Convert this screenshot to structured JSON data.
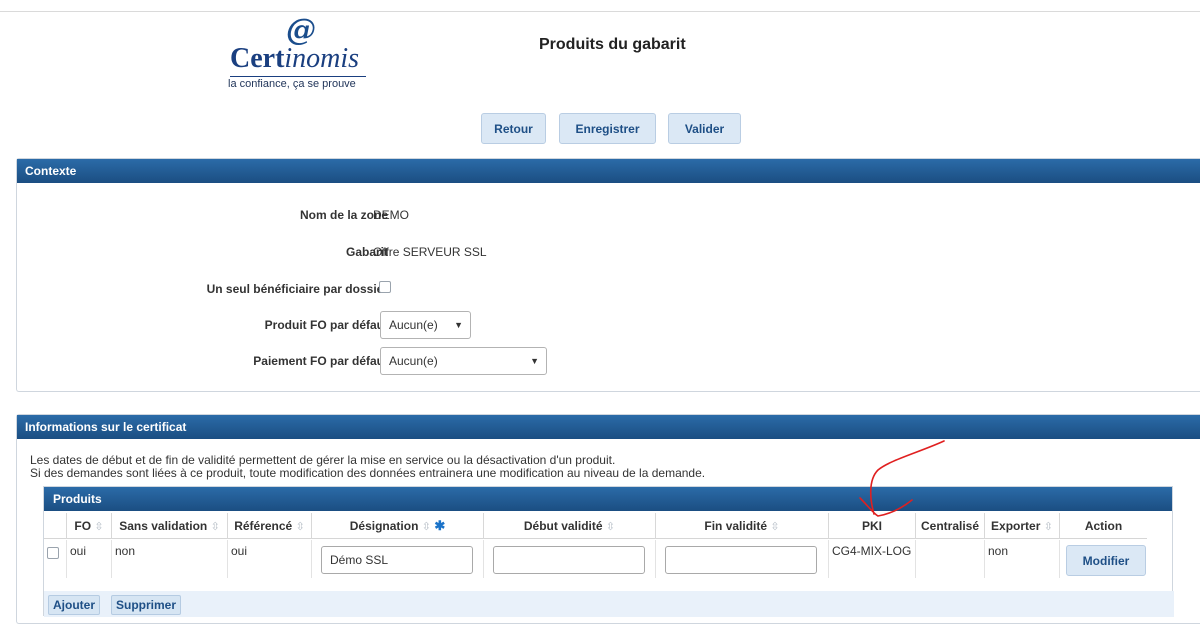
{
  "logo": {
    "at_symbol": "@",
    "word_bold": "Cert",
    "word_italic": "inomis",
    "tagline": "la confiance, ça se prouve"
  },
  "page_title": "Produits du gabarit",
  "toolbar": {
    "back_label": "Retour",
    "save_label": "Enregistrer",
    "validate_label": "Valider"
  },
  "context": {
    "title": "Contexte",
    "zone_label": "Nom de la zone",
    "zone_value": "DEMO",
    "template_label": "Gabarit",
    "template_value": "Offre SERVEUR SSL",
    "single_beneficiary_label": "Un seul bénéficiaire par dossier",
    "single_beneficiary_checked": false,
    "default_product_label": "Produit FO par défaut",
    "default_product_value": "Aucun(e)",
    "default_payment_label": "Paiement FO par défaut",
    "default_payment_value": "Aucun(e)"
  },
  "certificate": {
    "title": "Informations sur le certificat",
    "info_line1": "Les dates de début et de fin de validité permettent de gérer la mise en service ou la désactivation d'un produit.",
    "info_line2": "Si des demandes sont liées à ce produit, toute modification des données entrainera une modification au niveau de la demande."
  },
  "products": {
    "title": "Produits",
    "columns": {
      "fo": "FO",
      "sans_validation": "Sans validation",
      "reference": "Référencé",
      "designation": "Désignation",
      "start": "Début validité",
      "end": "Fin validité",
      "pki": "PKI",
      "centralized": "Centralisé",
      "export": "Exporter",
      "action": "Action"
    },
    "rows": [
      {
        "selected": false,
        "fo": "oui",
        "sans_validation": "non",
        "reference": "oui",
        "designation": "Démo SSL",
        "start": "",
        "end": "",
        "pki": "CG4-MIX-LOG",
        "centralized": "",
        "export": "non",
        "action_label": "Modifier"
      }
    ],
    "add_label": "Ajouter",
    "delete_label": "Supprimer"
  },
  "icons": {
    "sort": "sort-arrows-icon",
    "required": "asterisk-icon",
    "dropdown": "chevron-down-icon"
  },
  "colors": {
    "header_blue": "#1b4e82",
    "button_bg": "#dbe8f5",
    "annotation_red": "#e02020"
  }
}
